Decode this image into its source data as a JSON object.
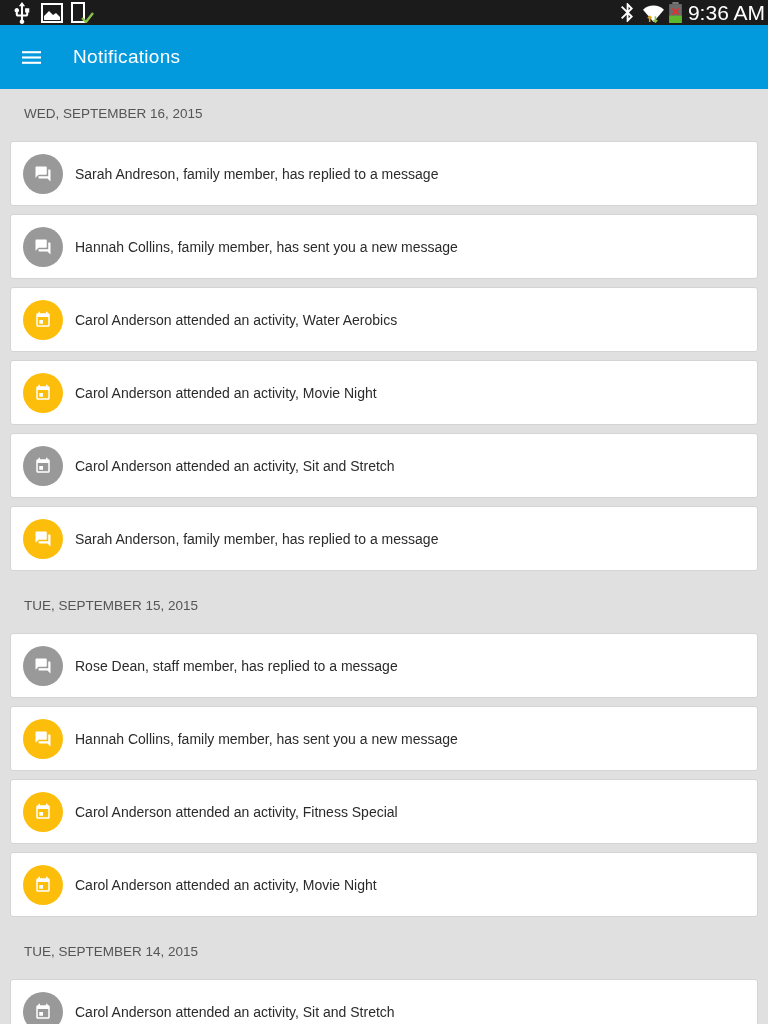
{
  "status_bar": {
    "time": "9:36 AM"
  },
  "app_bar": {
    "title": "Notifications"
  },
  "sections": [
    {
      "date": "WED, SEPTEMBER 16, 2015",
      "items": [
        {
          "kind": "message",
          "unread": false,
          "text": "Sarah Andreson, family member, has replied to a message"
        },
        {
          "kind": "message",
          "unread": false,
          "text": "Hannah Collins, family member, has sent you a new message"
        },
        {
          "kind": "activity",
          "unread": true,
          "text": "Carol Anderson attended an activity, Water Aerobics"
        },
        {
          "kind": "activity",
          "unread": true,
          "text": "Carol Anderson attended an activity, Movie Night"
        },
        {
          "kind": "activity",
          "unread": false,
          "text": "Carol Anderson attended an activity, Sit and Stretch"
        },
        {
          "kind": "message",
          "unread": true,
          "text": "Sarah Anderson, family member, has replied to a message"
        }
      ]
    },
    {
      "date": "TUE, SEPTEMBER 15, 2015",
      "items": [
        {
          "kind": "message",
          "unread": false,
          "text": "Rose Dean, staff member, has replied to a message"
        },
        {
          "kind": "message",
          "unread": true,
          "text": "Hannah Collins, family member, has sent you a new message"
        },
        {
          "kind": "activity",
          "unread": true,
          "text": "Carol Anderson attended an activity, Fitness Special"
        },
        {
          "kind": "activity",
          "unread": true,
          "text": "Carol Anderson attended an activity, Movie Night"
        }
      ]
    },
    {
      "date": "TUE, SEPTEMBER 14, 2015",
      "items": [
        {
          "kind": "activity",
          "unread": false,
          "text": "Carol Anderson attended an activity, Sit and Stretch"
        }
      ]
    }
  ]
}
